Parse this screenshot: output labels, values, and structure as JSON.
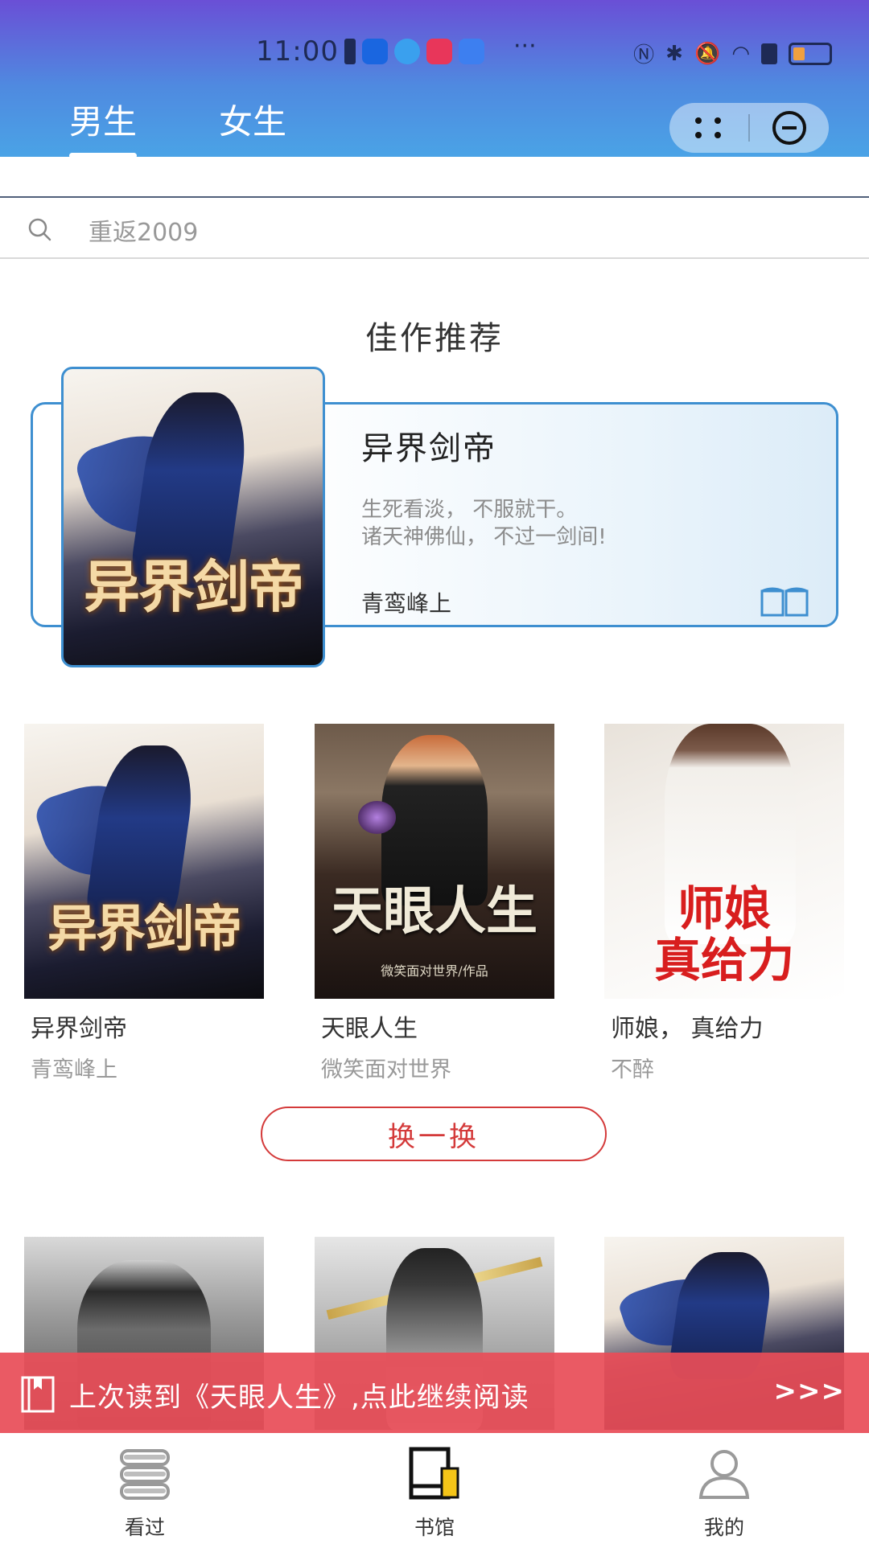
{
  "status_bar": {
    "time": "11:00",
    "overflow": "···"
  },
  "header": {
    "tabs": [
      {
        "label": "男生",
        "active": true
      },
      {
        "label": "女生",
        "active": false
      }
    ]
  },
  "search": {
    "placeholder": "重返2009"
  },
  "section": {
    "title": "佳作推荐"
  },
  "featured": {
    "title": "异界剑帝",
    "desc_line1": "生死看淡，  不服就干。",
    "desc_line2": "诸天神佛仙，  不过一剑间!",
    "author": "青鸾峰上",
    "cover_text": "异界剑帝"
  },
  "books": [
    {
      "title": "异界剑帝",
      "author": "青鸾峰上",
      "cover_text": "异界剑帝"
    },
    {
      "title": "天眼人生",
      "author": "微笑面对世界",
      "cover_text": "天眼人生",
      "cover_sub": "微笑面对世界/作品"
    },
    {
      "title": "师娘，  真给力",
      "author": "不醉",
      "cover_text_line1": "师娘",
      "cover_text_line2": "真给力"
    }
  ],
  "swap_button": {
    "label": "换一换"
  },
  "continue_banner": {
    "text": "上次读到《天眼人生》,点此继续阅读",
    "arrows": ">>>"
  },
  "bottom_nav": [
    {
      "label": "看过",
      "icon": "stack-icon",
      "active": false
    },
    {
      "label": "书馆",
      "icon": "bookshelf-icon",
      "active": true
    },
    {
      "label": "我的",
      "icon": "user-icon",
      "active": false
    }
  ],
  "colors": {
    "accent_red": "#d43a3a",
    "banner_red": "#e84e58",
    "featured_border": "#3e8fd0"
  }
}
